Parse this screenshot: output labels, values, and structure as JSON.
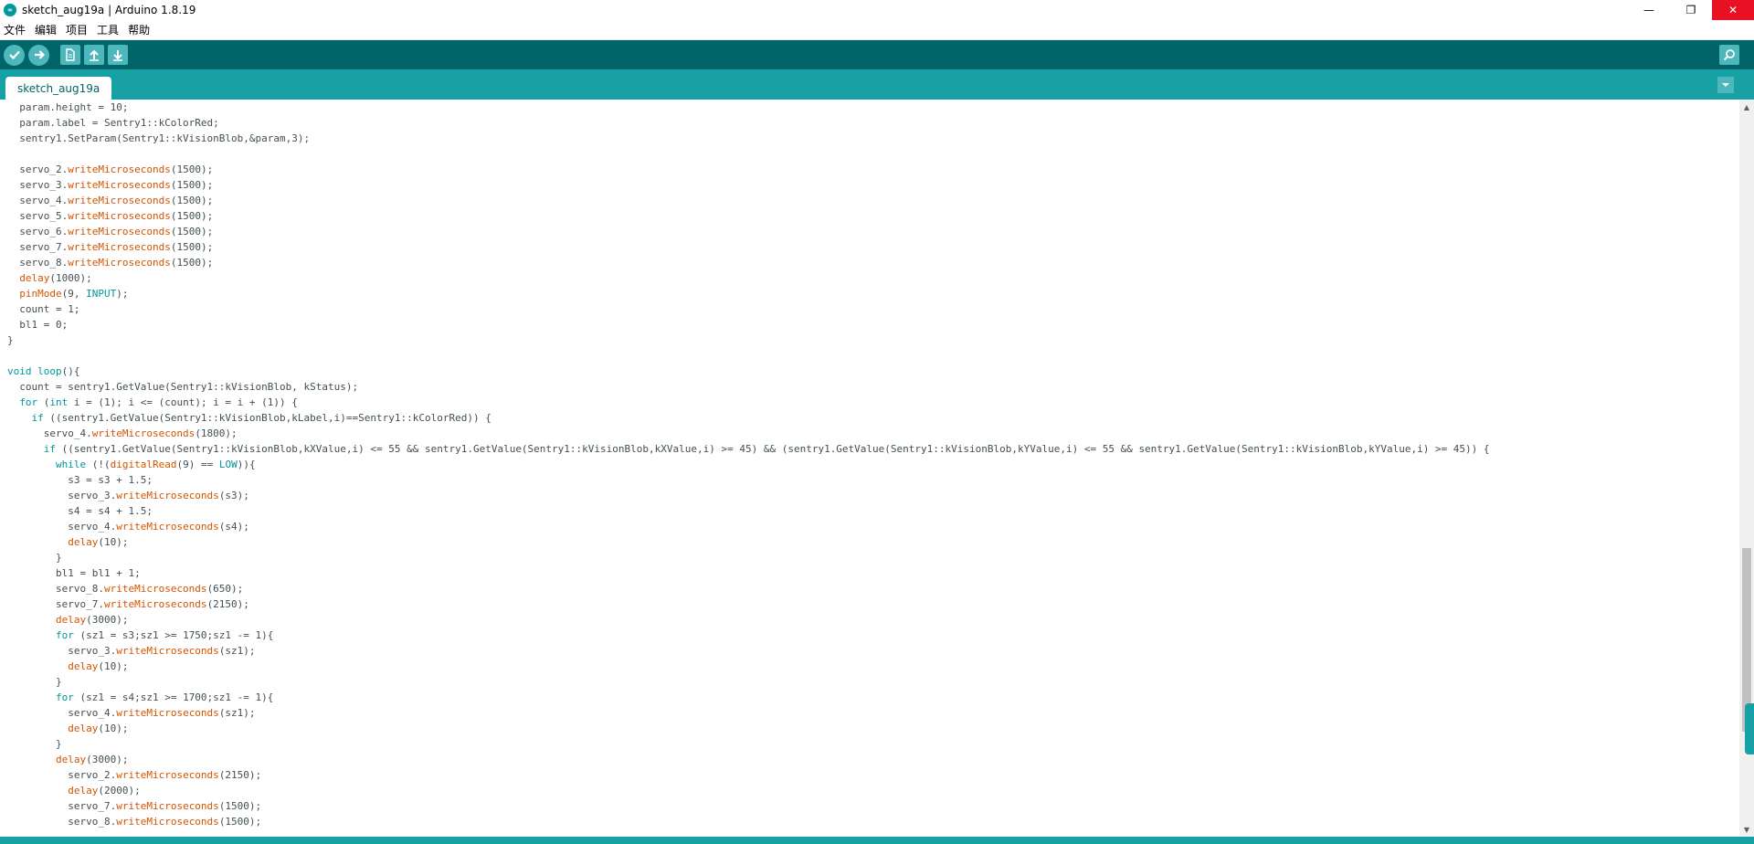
{
  "window": {
    "title": "sketch_aug19a | Arduino 1.8.19",
    "icon": "arduino-logo-icon",
    "controls": {
      "minimize": "—",
      "maximize": "❐",
      "close": "✕"
    }
  },
  "menu": {
    "items": [
      "文件",
      "编辑",
      "项目",
      "工具",
      "帮助"
    ]
  },
  "toolbar": {
    "buttons": [
      "verify-icon",
      "upload-icon",
      "new-icon",
      "open-icon",
      "save-icon"
    ],
    "serial_monitor": "serial-monitor-icon",
    "colors": {
      "bar": "#006468",
      "button": "#4db7bb"
    }
  },
  "tabs": {
    "active": "sketch_aug19a",
    "menu_icon": "tab-menu-icon"
  },
  "editor": {
    "lines": [
      "  param.height = 10;",
      "  param.label = Sentry1::kColorRed;",
      "  sentry1.SetParam(Sentry1::kVisionBlob,&param,3);",
      "",
      "  servo_2.writeMicroseconds(1500);",
      "  servo_3.writeMicroseconds(1500);",
      "  servo_4.writeMicroseconds(1500);",
      "  servo_5.writeMicroseconds(1500);",
      "  servo_6.writeMicroseconds(1500);",
      "  servo_7.writeMicroseconds(1500);",
      "  servo_8.writeMicroseconds(1500);",
      "  delay(1000);",
      "  pinMode(9, INPUT);",
      "  count = 1;",
      "  bl1 = 0;",
      "}",
      "",
      "void loop(){",
      "  count = sentry1.GetValue(Sentry1::kVisionBlob, kStatus);",
      "  for (int i = (1); i <= (count); i = i + (1)) {",
      "    if ((sentry1.GetValue(Sentry1::kVisionBlob,kLabel,i)==Sentry1::kColorRed)) {",
      "      servo_4.writeMicroseconds(1800);",
      "      if ((sentry1.GetValue(Sentry1::kVisionBlob,kXValue,i) <= 55 && sentry1.GetValue(Sentry1::kVisionBlob,kXValue,i) >= 45) && (sentry1.GetValue(Sentry1::kVisionBlob,kYValue,i) <= 55 && sentry1.GetValue(Sentry1::kVisionBlob,kYValue,i) >= 45)) {",
      "        while (!(digitalRead(9) == LOW)){",
      "          s3 = s3 + 1.5;",
      "          servo_3.writeMicroseconds(s3);",
      "          s4 = s4 + 1.5;",
      "          servo_4.writeMicroseconds(s4);",
      "          delay(10);",
      "        }",
      "        bl1 = bl1 + 1;",
      "        servo_8.writeMicroseconds(650);",
      "        servo_7.writeMicroseconds(2150);",
      "        delay(3000);",
      "        for (sz1 = s3;sz1 >= 1750;sz1 -= 1){",
      "          servo_3.writeMicroseconds(sz1);",
      "          delay(10);",
      "        }",
      "        for (sz1 = s4;sz1 >= 1700;sz1 -= 1){",
      "          servo_4.writeMicroseconds(sz1);",
      "          delay(10);",
      "        }",
      "        delay(3000);",
      "          servo_2.writeMicroseconds(2150);",
      "          delay(2000);",
      "          servo_7.writeMicroseconds(1500);",
      "          servo_8.writeMicroseconds(1500);"
    ],
    "highlight": {
      "functions": [
        "writeMicroseconds",
        "delay",
        "pinMode",
        "digitalRead"
      ],
      "keywords": [
        "void",
        "loop",
        "for",
        "int",
        "if",
        "while",
        "INPUT",
        "LOW"
      ],
      "colors": {
        "text": "#434f54",
        "function": "#d35400",
        "keyword": "#00979c"
      }
    }
  }
}
